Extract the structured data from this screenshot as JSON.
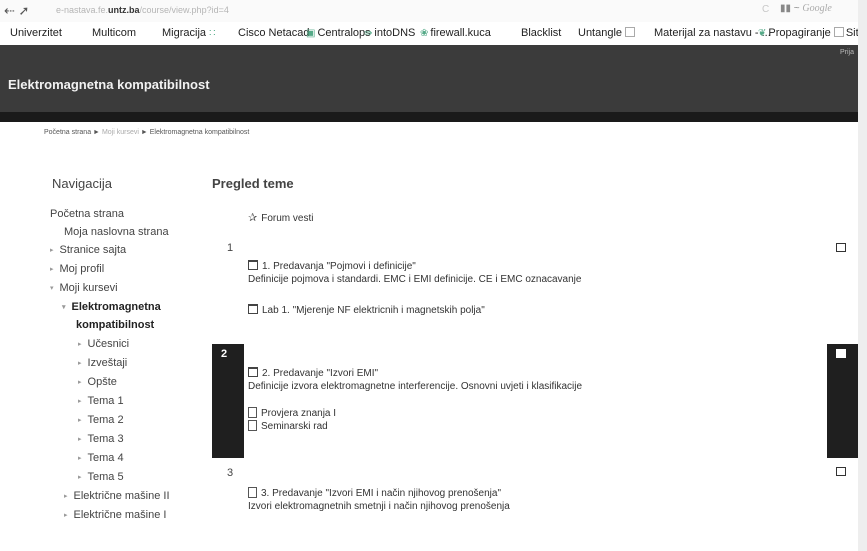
{
  "browser": {
    "nav_glyph": "⇠ ➚",
    "url_pre": "e-nastava.fe.",
    "url_domain": "untz.ba",
    "url_post": "/course/view.php?id=4",
    "reload_glyph": "C",
    "search_engine_prefix": "▮▮ ~",
    "search_engine": "Google"
  },
  "bookmarks": [
    {
      "label": "Univerzitet"
    },
    {
      "label": "Multicom"
    },
    {
      "label": "Migracija",
      "icon": "∷"
    },
    {
      "label": "Cisco Netacad",
      "icon": "▣"
    },
    {
      "label": "Centralops",
      "icon": "⇛"
    },
    {
      "label": "intoDNS",
      "icon": "❀"
    },
    {
      "label": "firewall.kuca"
    },
    {
      "label": "Blacklist"
    },
    {
      "label": "Untangle"
    },
    {
      "label": "Materijal za nastavu - ..."
    },
    {
      "label": "Propagiranje",
      "icon": "❦"
    },
    {
      "label": "Site"
    }
  ],
  "header": {
    "title": "Elektromagnetna kompatibilnost",
    "login": "Prija"
  },
  "breadcrumb": {
    "home": "Početna strana",
    "sep": "►",
    "my_courses": "Moji kursevi",
    "current": "Elektromagnetna kompatibilnost"
  },
  "navigation": {
    "title": "Navigacija",
    "items": [
      {
        "label": "Početna strana"
      },
      {
        "label": "Moja naslovna strana"
      },
      {
        "label": "Stranice sajta"
      },
      {
        "label": "Moj profil"
      },
      {
        "label": "Moji kursevi"
      },
      {
        "label": "Elektromagnetna"
      },
      {
        "label": "kompatibilnost"
      },
      {
        "label": "Učesnici"
      },
      {
        "label": "Izveštaji"
      },
      {
        "label": "Opšte"
      },
      {
        "label": "Tema 1"
      },
      {
        "label": "Tema 2"
      },
      {
        "label": "Tema 3"
      },
      {
        "label": "Tema 4"
      },
      {
        "label": "Tema 5"
      },
      {
        "label": "Električne mašine II"
      },
      {
        "label": "Električne mašine I"
      }
    ]
  },
  "main": {
    "title": "Pregled teme",
    "forum": "Forum vesti",
    "sections": [
      {
        "number": "1",
        "items": [
          "1. Predavanja \"Pojmovi i definicije\"",
          "Definicije pojmova i standardi. EMC i EMI definicije. CE i EMC oznacavanje",
          "Lab 1. \"Mjerenje NF elektricnih i magnetskih polja\""
        ]
      },
      {
        "number": "2",
        "items": [
          "2. Predavanje \"Izvori EMI\"",
          "Definicije izvora elektromagnetne interferencije. Osnovni uvjeti i klasifikacije",
          "Provjera znanja I",
          "Seminarski rad"
        ]
      },
      {
        "number": "3",
        "items": [
          "3. Predavanje \"Izvori EMI i način njihovog prenošenja\"",
          "Izvori elektromagnetnih smetnji i način njihovog prenošenja"
        ]
      }
    ]
  }
}
